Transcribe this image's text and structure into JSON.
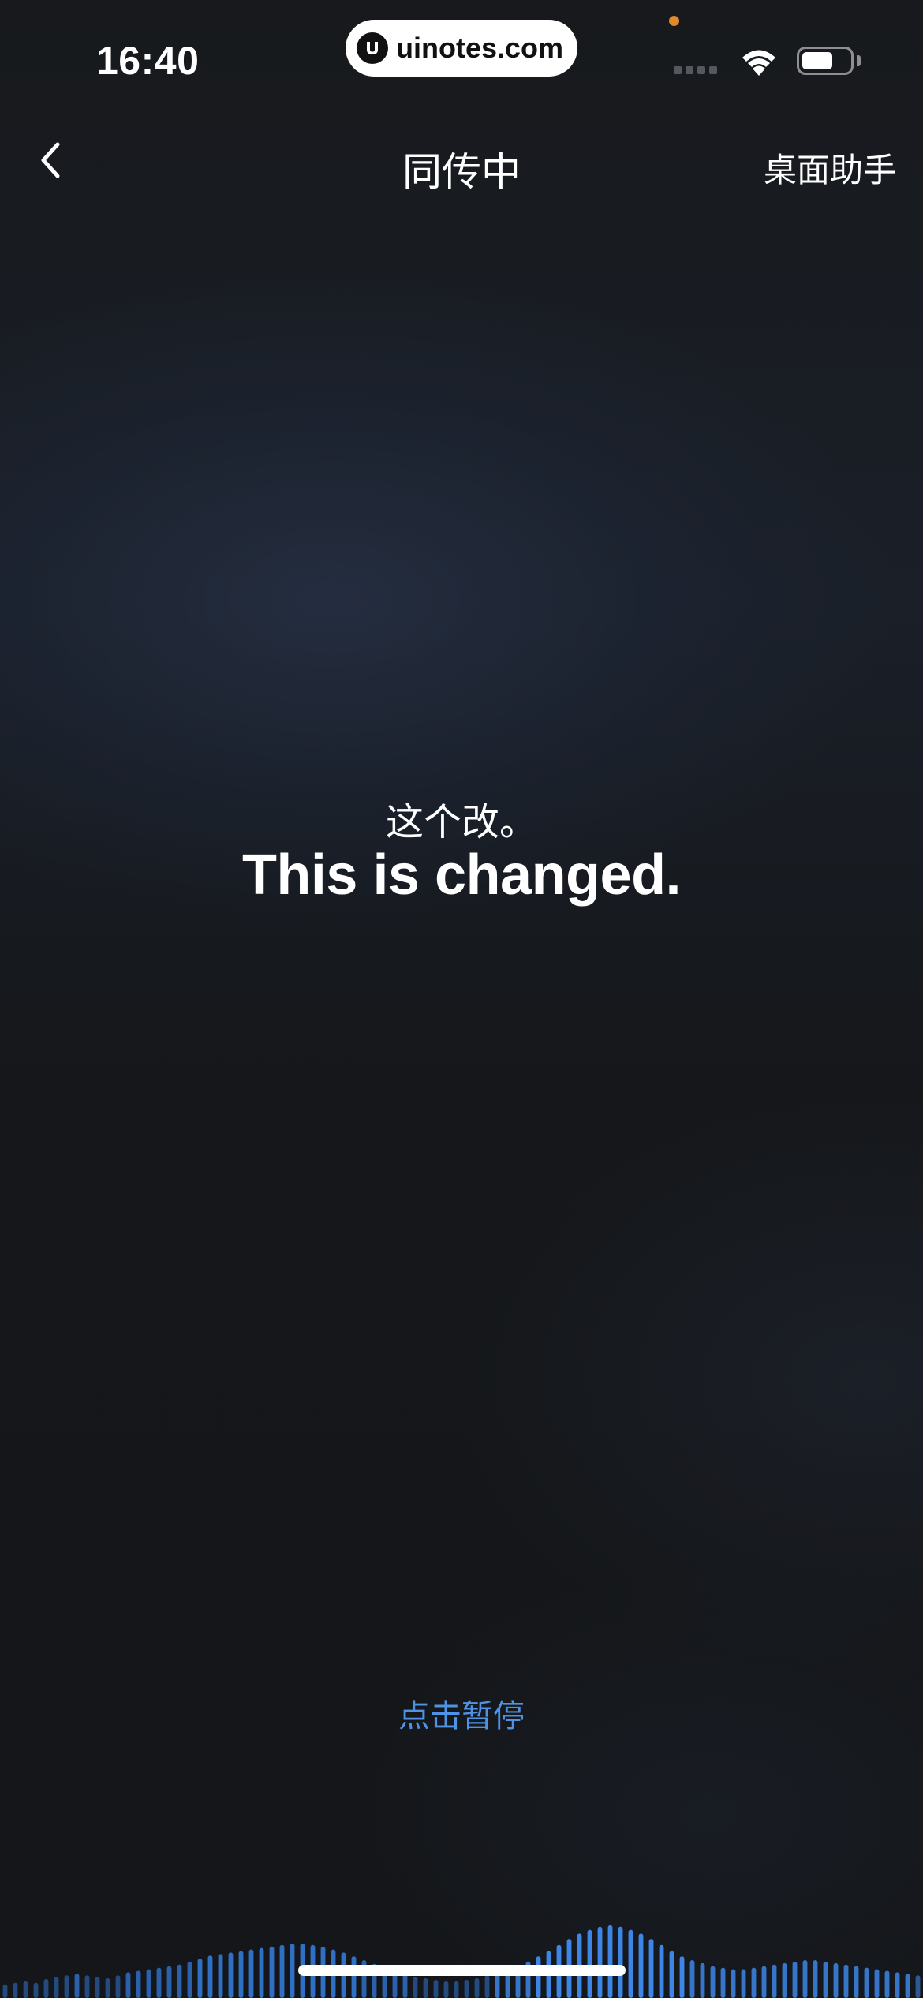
{
  "status_bar": {
    "time": "16:40",
    "url": "uinotes.com"
  },
  "nav": {
    "title": "同传中",
    "right_action": "桌面助手"
  },
  "content": {
    "source_text": "这个改。",
    "translated_text": "This is changed."
  },
  "controls": {
    "pause_label": "点击暂停"
  },
  "icons": {
    "back": "chevron-left-icon",
    "wifi": "wifi-icon",
    "battery": "battery-icon",
    "logo": "uinotes-logo-icon"
  },
  "colors": {
    "background": "#141619",
    "accent": "#4f93e6",
    "text": "#ffffff",
    "mic_indicator": "#e08a2b"
  },
  "waveform": {
    "levels": [
      0.18,
      0.2,
      0.22,
      0.2,
      0.25,
      0.28,
      0.3,
      0.32,
      0.3,
      0.28,
      0.26,
      0.3,
      0.34,
      0.36,
      0.38,
      0.4,
      0.42,
      0.44,
      0.48,
      0.52,
      0.56,
      0.58,
      0.6,
      0.62,
      0.64,
      0.66,
      0.68,
      0.7,
      0.72,
      0.72,
      0.7,
      0.68,
      0.64,
      0.6,
      0.55,
      0.5,
      0.45,
      0.4,
      0.36,
      0.32,
      0.28,
      0.26,
      0.24,
      0.22,
      0.22,
      0.24,
      0.26,
      0.3,
      0.34,
      0.38,
      0.42,
      0.48,
      0.55,
      0.62,
      0.7,
      0.78,
      0.85,
      0.9,
      0.94,
      0.96,
      0.94,
      0.9,
      0.85,
      0.78,
      0.7,
      0.62,
      0.55,
      0.5,
      0.46,
      0.42,
      0.4,
      0.38,
      0.38,
      0.4,
      0.42,
      0.44,
      0.46,
      0.48,
      0.5,
      0.5,
      0.48,
      0.46,
      0.44,
      0.42,
      0.4,
      0.38,
      0.36,
      0.34,
      0.32,
      0.3
    ]
  }
}
